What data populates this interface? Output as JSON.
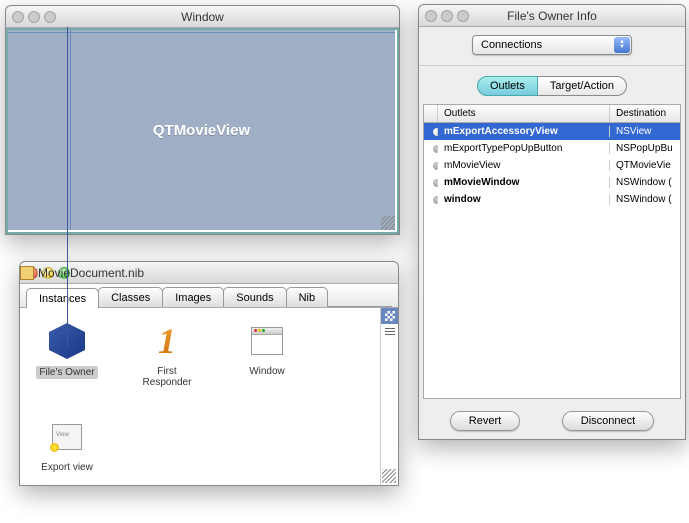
{
  "win1": {
    "title": "Window",
    "view_label": "QTMovieView"
  },
  "win2": {
    "title": "MovieDocument.nib",
    "tabs": [
      "Instances",
      "Classes",
      "Images",
      "Sounds",
      "Nib"
    ],
    "items": {
      "owner": "File's Owner",
      "responder": "First Responder",
      "window": "Window",
      "export": "Export view"
    }
  },
  "win3": {
    "title": "File's Owner Info",
    "popup": "Connections",
    "segments": {
      "outlets": "Outlets",
      "target": "Target/Action"
    },
    "columns": {
      "c0": "",
      "c1": "Outlets",
      "c2": "Destination"
    },
    "rows": [
      {
        "name": "mExportAccessoryView",
        "dest": "NSView",
        "selected": true,
        "bold": true
      },
      {
        "name": "mExportTypePopUpButton",
        "dest": "NSPopUpBu",
        "selected": false,
        "bold": false
      },
      {
        "name": "mMovieView",
        "dest": "QTMovieVie",
        "selected": false,
        "bold": false
      },
      {
        "name": "mMovieWindow",
        "dest": "NSWindow (",
        "selected": false,
        "bold": true
      },
      {
        "name": "window",
        "dest": "NSWindow (",
        "selected": false,
        "bold": true
      }
    ],
    "buttons": {
      "revert": "Revert",
      "disconnect": "Disconnect"
    }
  }
}
